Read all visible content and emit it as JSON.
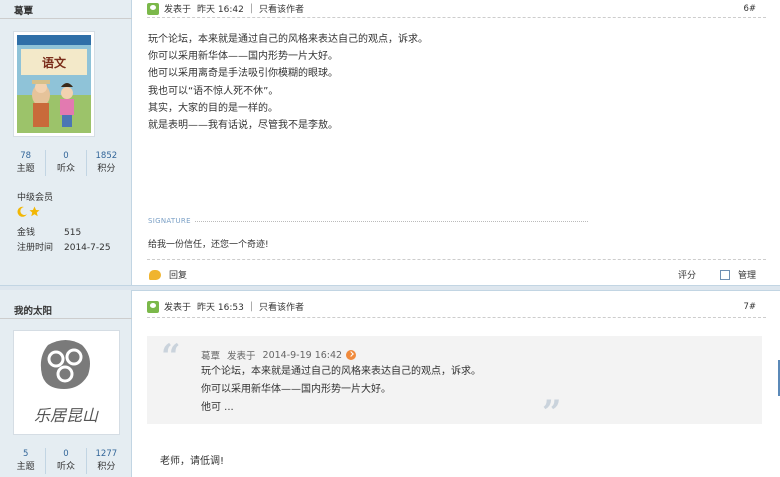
{
  "posts": [
    {
      "author": "葛覃",
      "stats": [
        {
          "num": "78",
          "label": "主题"
        },
        {
          "num": "0",
          "label": "听众"
        },
        {
          "num": "1852",
          "label": "积分"
        }
      ],
      "group": "中级会员",
      "info": [
        {
          "key": "金钱",
          "value": "515"
        },
        {
          "key": "注册时间",
          "value": "2014-7-25"
        }
      ],
      "post_prefix": "发表于",
      "post_time": "昨天 16:42",
      "only_author": "只看该作者",
      "floor": "6#",
      "content": [
        "玩个论坛，本来就是通过自己的风格来表达自己的观点，诉求。",
        "你可以采用新华体——国内形势一片大好。",
        "他可以采用离奇是手法吸引你模糊的眼球。",
        "我也可以“语不惊人死不休”。",
        "其实，大家的目的是一样的。",
        "就是表明——我有话说，尽管我不是李敖。"
      ],
      "signature_label": "SIGNATURE",
      "signature": "给我一份信任，还您一个奇迹!",
      "reply_label": "回复",
      "rate_label": "评分",
      "manage_label": "管理"
    },
    {
      "author": "我的太阳",
      "stats": [
        {
          "num": "5",
          "label": "主题"
        },
        {
          "num": "0",
          "label": "听众"
        },
        {
          "num": "1277",
          "label": "积分"
        }
      ],
      "post_prefix": "发表于",
      "post_time": "昨天 16:53",
      "only_author": "只看该作者",
      "floor": "7#",
      "quote": {
        "author": "葛覃",
        "prefix": "发表于",
        "time": "2014-9-19 16:42",
        "lines": [
          "玩个论坛，本来就是通过自己的风格来表达自己的观点，诉求。",
          "你可以采用新华体——国内形势一片大好。",
          "他可 ..."
        ]
      },
      "reply": "老师，请低调!"
    }
  ],
  "avatar_book_title": "语文",
  "avatar_calligraphy": "乐居昆山",
  "colors": {
    "sidebar_bg": "#e5edf2",
    "link_blue": "#336699",
    "online_green": "#7bb84a",
    "reply_orange": "#f0b42e",
    "quote_bg": "#f3f3f3"
  }
}
